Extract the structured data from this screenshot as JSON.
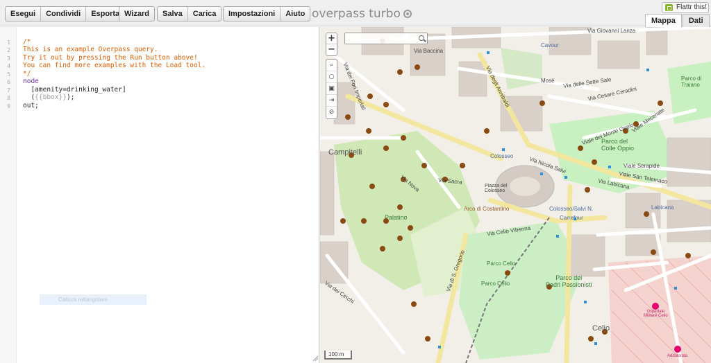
{
  "toolbar": {
    "buttons_group1": [
      "Esegui",
      "Condividi",
      "Esporta"
    ],
    "buttons_group2": [
      "Wizard"
    ],
    "buttons_group3": [
      "Salva",
      "Carica"
    ],
    "buttons_group4": [
      "Impostazioni",
      "Aiuto"
    ],
    "title": "overpass turbo",
    "flattr_label": "Flattr this!",
    "tabs": [
      "Mappa",
      "Dati"
    ]
  },
  "editor": {
    "line_numbers": [
      "1",
      "2",
      "3",
      "4",
      "5",
      "6",
      "7",
      "8",
      "9"
    ],
    "lines": {
      "l1": "/*",
      "l2": "This is an example Overpass query.",
      "l3": "Try it out by pressing the Run button above!",
      "l4": "You can find more examples with the Load tool.",
      "l5": "*/",
      "l6": "node",
      "l7": "  [amenity=drinking_water]",
      "l8_pre": "  (",
      "l8_tmpl": "{{bbox}}",
      "l8_post": ");",
      "l9": "out;"
    },
    "capture_hint": "Cattura rettangolare"
  },
  "map": {
    "zoom_in": "+",
    "zoom_out": "−",
    "scale_label": "100 m",
    "labels": {
      "cavour": "Cavour",
      "via_giovanni_lanza": "Via Giovanni Lanza",
      "via_baccina": "Via Baccina",
      "via_dei_fori": "Via dei Fori Imperiali",
      "via_degli_annibaldi": "Via degli Annibaldi",
      "parco_di_traiano": "Parco di\nTraiano",
      "via_delle_sette_sale": "Via delle Sette Sale",
      "via_cesare_ceradini": "Via Cesare Ceradini",
      "viale_del_monte_oppio": "Viale del Monte Oppio",
      "viale_mecenate": "Viale Mecenate",
      "mose": "Mosè",
      "parco_del_colle_oppio": "Parco del\nColle Oppio",
      "campitelli": "Campitelli",
      "colosseo": "Colosseo",
      "via_nicola_salvi": "Via Nicola Salvi",
      "via_labicana": "Via Labicana",
      "via_san_telemaco": "Viale San Telemaco",
      "viale_serapide": "Viale Serapide",
      "piazza_del_colosseo": "Piazza del\nColosseo",
      "via_sacra": "Via Sacra",
      "arco_di_costantino": "Arco di Costantino",
      "colosseo_salvi": "Colosseo/Salvi N.",
      "carrefour": "Carrefour",
      "palatino": "Palatino",
      "via_celio_vibenna": "Via Celio Vibenna",
      "labicana": "Labicana",
      "parco_celio": "Parco Celio",
      "parco_dei_padri": "Parco dei\nPadri Passionisti",
      "via_dei_cerchi": "Via dei Cerchi",
      "celio": "Celio",
      "ospedale": "Ospedale\nMilitare Celio",
      "addolorata": "Addolorata",
      "via_nova": "Via Nova",
      "via_di_s_gregorio": "Via di S. Gregorio"
    }
  },
  "colors": {
    "accent": "#d65c00",
    "keyword": "#6c2ca0",
    "park": "#c8facc",
    "road_major": "#f7fabf",
    "marker": "#8a4b12"
  }
}
